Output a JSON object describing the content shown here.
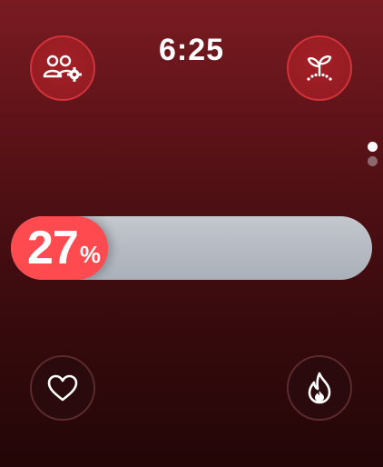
{
  "status": {
    "time": "6:25"
  },
  "progress": {
    "value": "27",
    "unit": "%",
    "fraction": 0.27,
    "fill_color": "#ff4a4f",
    "track_color": "#b5bac2"
  },
  "buttons": {
    "top_left_icon": "people-settings-icon",
    "top_right_icon": "sprout-icon",
    "bottom_left_icon": "heart-icon",
    "bottom_right_icon": "flame-icon"
  },
  "pagination": {
    "count": 2,
    "active_index": 0
  },
  "colors": {
    "accent": "#d2323a",
    "background_top": "#7a1b22",
    "background_bottom": "#230607"
  }
}
